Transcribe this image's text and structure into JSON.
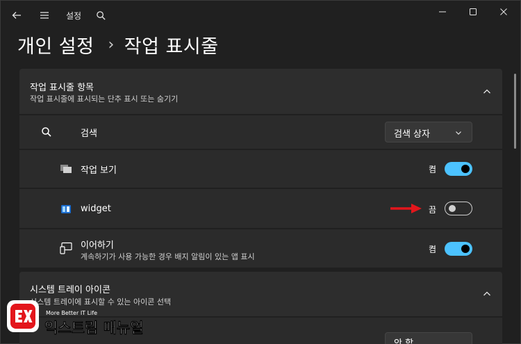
{
  "titlebar": {
    "title": "설정",
    "back_icon": "arrow-left-icon",
    "menu_icon": "hamburger-menu-icon",
    "search_icon": "search-icon"
  },
  "breadcrumb": {
    "parent": "개인 설정",
    "separator": "›",
    "current": "작업 표시줄"
  },
  "section_taskbar_items": {
    "title": "작업 표시줄 항목",
    "subtitle": "작업 표시줄에 표시되는 단추 표시 또는 숨기기",
    "items": [
      {
        "label": "검색",
        "control": "select",
        "value": "검색 상자",
        "icon": "search-icon"
      },
      {
        "label": "작업 보기",
        "control": "toggle",
        "state_label": "켬",
        "on": true,
        "icon": "task-view-icon"
      },
      {
        "label": "widget",
        "control": "toggle",
        "state_label": "끔",
        "on": false,
        "icon": "widget-icon"
      },
      {
        "label": "이어하기",
        "sublabel": "계속하기가 사용 가능한 경우 배지 알림이 있는 앱 표시",
        "control": "toggle",
        "state_label": "켬",
        "on": true,
        "icon": "continue-phone-icon"
      }
    ]
  },
  "section_system_tray": {
    "title": "시스템 트레이 아이콘",
    "subtitle": "시스템 트레이에 표시할 수 있는 아이콘 선택"
  },
  "next_row": {
    "partial_select_value": "안 함"
  },
  "watermark": {
    "logo_text": "EX",
    "small_text": "More Better IT Life",
    "big_text": "익스트림 매뉴얼"
  },
  "colors": {
    "background": "#202020",
    "card": "#2b2b2b",
    "accent": "#4cc2ff",
    "arrow": "#e3161c"
  }
}
